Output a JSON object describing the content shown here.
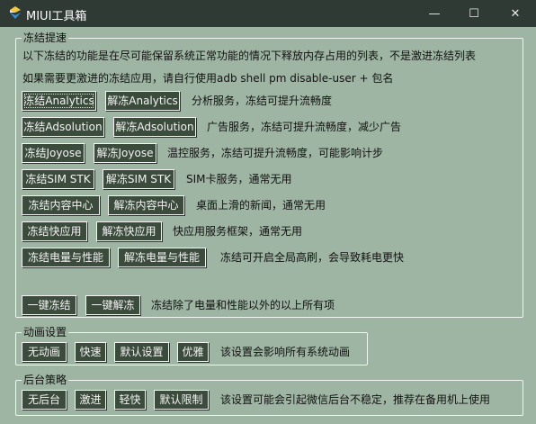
{
  "window": {
    "title": "MIUI工具箱",
    "min_glyph": "—",
    "max_glyph": "☐",
    "close_glyph": "✕"
  },
  "freeze": {
    "legend": "冻结提速",
    "desc1": "以下冻结的功能是在尽可能保留系统正常功能的情况下释放内存占用的列表，不是激进冻结列表",
    "desc2": "如果需要更激进的冻结应用，请自行使用adb shell pm disable-user + 包名",
    "rows": [
      {
        "freeze": "冻结Analytics",
        "unfreeze": "解冻Analytics",
        "note": "分析服务，冻结可提升流畅度"
      },
      {
        "freeze": "冻结Adsolution",
        "unfreeze": "解冻Adsolution",
        "note": "广告服务，冻结可提升流畅度，减少广告"
      },
      {
        "freeze": "冻结Joyose",
        "unfreeze": "解冻Joyose",
        "note": "温控服务，冻结可提升流畅度，可能影响计步"
      },
      {
        "freeze": "冻结SIM STK",
        "unfreeze": "解冻SIM STK",
        "note": "SIM卡服务，通常无用"
      },
      {
        "freeze": "冻结内容中心",
        "unfreeze": "解冻内容中心",
        "note": "桌面上滑的新闻，通常无用"
      },
      {
        "freeze": "冻结快应用",
        "unfreeze": "解冻快应用",
        "note": "快应用服务框架，通常无用"
      },
      {
        "freeze": "冻结电量与性能",
        "unfreeze": "解冻电量与性能",
        "note": "冻结可开启全局高刷，会导致耗电更快"
      }
    ],
    "one_key_freeze": "一键冻结",
    "one_key_unfreeze": "一键解冻",
    "one_key_note": "冻结除了电量和性能以外的以上所有项"
  },
  "animation": {
    "legend": "动画设置",
    "buttons": [
      "无动画",
      "快速",
      "默认设置",
      "优雅"
    ],
    "note": "该设置会影响所有系统动画"
  },
  "background": {
    "legend": "后台策略",
    "buttons": [
      "无后台",
      "激进",
      "轻快",
      "默认限制"
    ],
    "note": "该设置可能会引起微信后台不稳定，推荐在备用机上使用"
  },
  "colors": {
    "titlebar": "#2f3a34",
    "background": "#9fb5a3",
    "button": "#3b4b3c"
  }
}
